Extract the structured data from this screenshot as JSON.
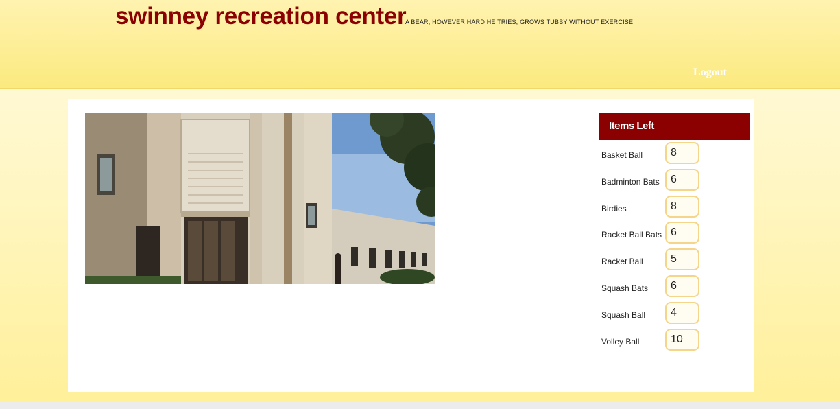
{
  "header": {
    "title": "swinney recreation center",
    "tagline": "A BEAR, HOWEVER HARD HE TRIES, GROWS TUBBY WITHOUT EXERCISE.",
    "logout_label": "Logout"
  },
  "hero_image": {
    "icon": "gymnasium-building-photo"
  },
  "sidebar": {
    "heading": "Items Left",
    "items": [
      {
        "label": "Basket Ball",
        "count": "8"
      },
      {
        "label": "Badminton Bats",
        "count": "6"
      },
      {
        "label": "Birdies",
        "count": "8"
      },
      {
        "label": "Racket Ball Bats",
        "count": "6"
      },
      {
        "label": "Racket Ball",
        "count": "5"
      },
      {
        "label": "Squash Bats",
        "count": "6"
      },
      {
        "label": "Squash Ball",
        "count": "4"
      },
      {
        "label": "Volley Ball",
        "count": "10"
      }
    ]
  },
  "colors": {
    "brand": "#8b0000",
    "header_bg": "#fdee96",
    "count_border": "#f4d58a"
  }
}
